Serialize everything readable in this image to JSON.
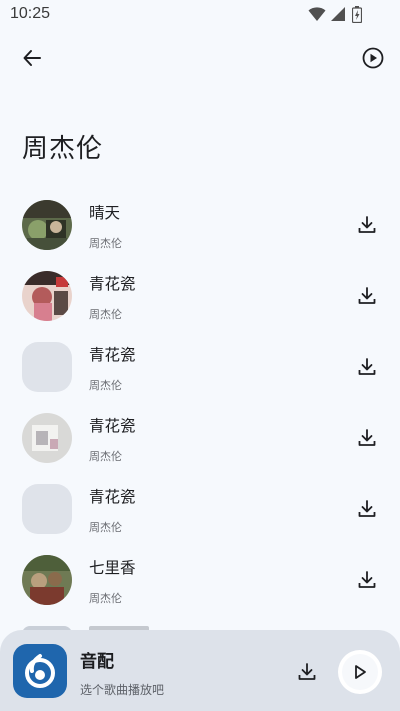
{
  "status_bar": {
    "time": "10:25",
    "icons": [
      "wifi-icon",
      "signal-icon",
      "battery-icon"
    ]
  },
  "top_bar": {
    "back_icon": "arrow-left-icon",
    "play_all_icon": "play-circle-icon"
  },
  "artist": {
    "name": "周杰伦"
  },
  "songs": [
    {
      "title": "晴天",
      "artist": "周杰伦",
      "cover": "art",
      "cover_colors": [
        "#3b3a2e",
        "#8aa06a"
      ]
    },
    {
      "title": "青花瓷",
      "artist": "周杰伦",
      "cover": "art",
      "cover_colors": [
        "#b35b5b",
        "#e9d3cc"
      ]
    },
    {
      "title": "青花瓷",
      "artist": "周杰伦",
      "cover": "placeholder"
    },
    {
      "title": "青花瓷",
      "artist": "周杰伦",
      "cover": "art",
      "cover_colors": [
        "#e6e6e4",
        "#b7b4b8"
      ]
    },
    {
      "title": "青花瓷",
      "artist": "周杰伦",
      "cover": "placeholder"
    },
    {
      "title": "七里香",
      "artist": "周杰伦",
      "cover": "art",
      "cover_colors": [
        "#4e5f3a",
        "#b99f7e"
      ]
    }
  ],
  "player": {
    "title": "音配",
    "subtitle": "选个歌曲播放吧",
    "logo_icon": "app-logo-icon",
    "download_icon": "download-icon",
    "play_icon": "play-icon"
  },
  "colors": {
    "background": "#f6f9fd",
    "player_bar": "#dde2ea",
    "logo_blue": "#1f66ad",
    "placeholder": "#dfe3ea"
  }
}
